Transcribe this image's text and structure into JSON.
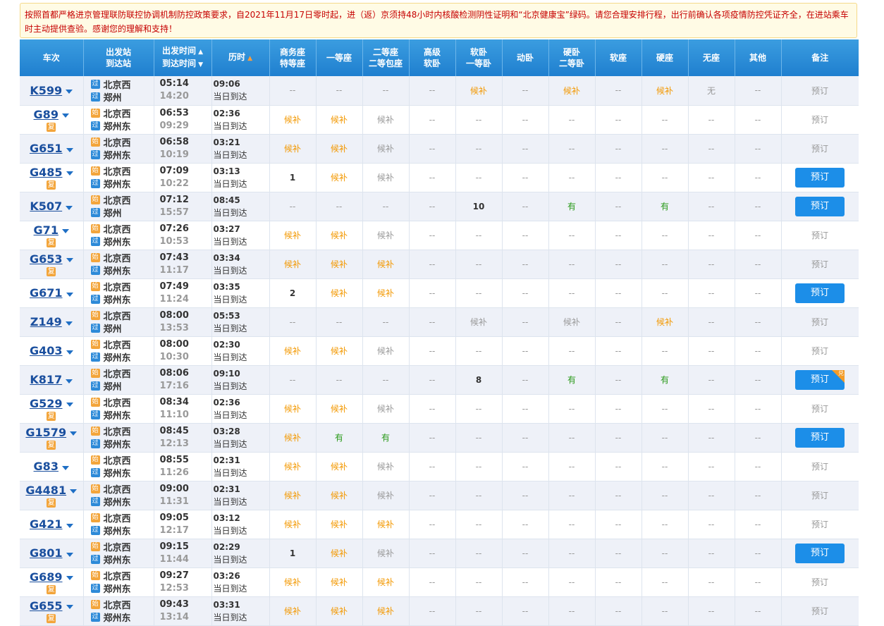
{
  "notice": "按照首都严格进京管理联防联控协调机制防控政策要求，自2021年11月17日零时起，进（返）京须持48小时内核酸检测阴性证明和“北京健康宝”绿码。请您合理安排行程，出行前确认各项疫情防控凭证齐全，在进站乘车时主动提供查验。感谢您的理解和支持！",
  "headers": {
    "train": "车次",
    "station_top": "出发站",
    "station_bot": "到达站",
    "time_top": "出发时间",
    "time_bot": "到达时间",
    "duration": "历时",
    "business_top": "商务座",
    "business_bot": "特等座",
    "first": "一等座",
    "second_top": "二等座",
    "second_bot": "二等包座",
    "high_soft_top": "高级",
    "high_soft_bot": "软卧",
    "soft_top": "软卧",
    "soft_bot": "一等卧",
    "dong": "动卧",
    "hard_top": "硬卧",
    "hard_bot": "二等卧",
    "soft_seat": "软座",
    "hard_seat": "硬座",
    "no_seat": "无座",
    "other": "其他",
    "note": "备注"
  },
  "labels": {
    "shi": "始",
    "guo": "过",
    "fu": "复",
    "same_day": "当日到达",
    "book": "预订",
    "dui": "兑"
  },
  "colors": {
    "header": "#1f7fcf",
    "book_button": "#1c8ee8",
    "waitlist": "#f39800",
    "available": "#2a9a1a",
    "alert_text": "#c60000"
  },
  "rows": [
    {
      "train": "K599",
      "fu": false,
      "from": "北京西",
      "to": "郑州",
      "from_badge": "guo",
      "dep": "05:14",
      "arr": "14:20",
      "dur": "09:06",
      "seats": [
        [
          "--",
          "g"
        ],
        [
          "--",
          "g"
        ],
        [
          "--",
          "g"
        ],
        [
          "--",
          "g"
        ],
        [
          "候补",
          "o"
        ],
        [
          "--",
          "g"
        ],
        [
          "候补",
          "o"
        ],
        [
          "--",
          "g"
        ],
        [
          "候补",
          "o"
        ],
        [
          "无",
          "g"
        ],
        [
          "--",
          "g"
        ]
      ],
      "book_active": false,
      "corner": false
    },
    {
      "train": "G89",
      "fu": true,
      "from": "北京西",
      "to": "郑州东",
      "from_badge": "shi",
      "dep": "06:53",
      "arr": "09:29",
      "dur": "02:36",
      "seats": [
        [
          "候补",
          "o"
        ],
        [
          "候补",
          "o"
        ],
        [
          "候补",
          "g"
        ],
        [
          "--",
          "g"
        ],
        [
          "--",
          "g"
        ],
        [
          "--",
          "g"
        ],
        [
          "--",
          "g"
        ],
        [
          "--",
          "g"
        ],
        [
          "--",
          "g"
        ],
        [
          "--",
          "g"
        ],
        [
          "--",
          "g"
        ]
      ],
      "book_active": false,
      "corner": false
    },
    {
      "train": "G651",
      "fu": false,
      "from": "北京西",
      "to": "郑州东",
      "from_badge": "shi",
      "dep": "06:58",
      "arr": "10:19",
      "dur": "03:21",
      "seats": [
        [
          "候补",
          "o"
        ],
        [
          "候补",
          "o"
        ],
        [
          "候补",
          "g"
        ],
        [
          "--",
          "g"
        ],
        [
          "--",
          "g"
        ],
        [
          "--",
          "g"
        ],
        [
          "--",
          "g"
        ],
        [
          "--",
          "g"
        ],
        [
          "--",
          "g"
        ],
        [
          "--",
          "g"
        ],
        [
          "--",
          "g"
        ]
      ],
      "book_active": false,
      "corner": false
    },
    {
      "train": "G485",
      "fu": true,
      "from": "北京西",
      "to": "郑州东",
      "from_badge": "shi",
      "dep": "07:09",
      "arr": "10:22",
      "dur": "03:13",
      "seats": [
        [
          "1",
          "n"
        ],
        [
          "候补",
          "o"
        ],
        [
          "候补",
          "g"
        ],
        [
          "--",
          "g"
        ],
        [
          "--",
          "g"
        ],
        [
          "--",
          "g"
        ],
        [
          "--",
          "g"
        ],
        [
          "--",
          "g"
        ],
        [
          "--",
          "g"
        ],
        [
          "--",
          "g"
        ],
        [
          "--",
          "g"
        ]
      ],
      "book_active": true,
      "corner": false
    },
    {
      "train": "K507",
      "fu": false,
      "from": "北京西",
      "to": "郑州",
      "from_badge": "shi",
      "dep": "07:12",
      "arr": "15:57",
      "dur": "08:45",
      "seats": [
        [
          "--",
          "g"
        ],
        [
          "--",
          "g"
        ],
        [
          "--",
          "g"
        ],
        [
          "--",
          "g"
        ],
        [
          "10",
          "n"
        ],
        [
          "--",
          "g"
        ],
        [
          "有",
          "gr"
        ],
        [
          "--",
          "g"
        ],
        [
          "有",
          "gr"
        ],
        [
          "--",
          "g"
        ],
        [
          "--",
          "g"
        ]
      ],
      "book_active": true,
      "corner": false
    },
    {
      "train": "G71",
      "fu": true,
      "from": "北京西",
      "to": "郑州东",
      "from_badge": "shi",
      "dep": "07:26",
      "arr": "10:53",
      "dur": "03:27",
      "seats": [
        [
          "候补",
          "o"
        ],
        [
          "候补",
          "o"
        ],
        [
          "候补",
          "g"
        ],
        [
          "--",
          "g"
        ],
        [
          "--",
          "g"
        ],
        [
          "--",
          "g"
        ],
        [
          "--",
          "g"
        ],
        [
          "--",
          "g"
        ],
        [
          "--",
          "g"
        ],
        [
          "--",
          "g"
        ],
        [
          "--",
          "g"
        ]
      ],
      "book_active": false,
      "corner": false
    },
    {
      "train": "G653",
      "fu": true,
      "from": "北京西",
      "to": "郑州东",
      "from_badge": "shi",
      "dep": "07:43",
      "arr": "11:17",
      "dur": "03:34",
      "seats": [
        [
          "候补",
          "o"
        ],
        [
          "候补",
          "o"
        ],
        [
          "候补",
          "o"
        ],
        [
          "--",
          "g"
        ],
        [
          "--",
          "g"
        ],
        [
          "--",
          "g"
        ],
        [
          "--",
          "g"
        ],
        [
          "--",
          "g"
        ],
        [
          "--",
          "g"
        ],
        [
          "--",
          "g"
        ],
        [
          "--",
          "g"
        ]
      ],
      "book_active": false,
      "corner": false
    },
    {
      "train": "G671",
      "fu": false,
      "from": "北京西",
      "to": "郑州东",
      "from_badge": "shi",
      "dep": "07:49",
      "arr": "11:24",
      "dur": "03:35",
      "seats": [
        [
          "2",
          "n"
        ],
        [
          "候补",
          "o"
        ],
        [
          "候补",
          "o"
        ],
        [
          "--",
          "g"
        ],
        [
          "--",
          "g"
        ],
        [
          "--",
          "g"
        ],
        [
          "--",
          "g"
        ],
        [
          "--",
          "g"
        ],
        [
          "--",
          "g"
        ],
        [
          "--",
          "g"
        ],
        [
          "--",
          "g"
        ]
      ],
      "book_active": true,
      "corner": false
    },
    {
      "train": "Z149",
      "fu": false,
      "from": "北京西",
      "to": "郑州",
      "from_badge": "shi",
      "dep": "08:00",
      "arr": "13:53",
      "dur": "05:53",
      "seats": [
        [
          "--",
          "g"
        ],
        [
          "--",
          "g"
        ],
        [
          "--",
          "g"
        ],
        [
          "--",
          "g"
        ],
        [
          "候补",
          "g"
        ],
        [
          "--",
          "g"
        ],
        [
          "候补",
          "g"
        ],
        [
          "--",
          "g"
        ],
        [
          "候补",
          "o"
        ],
        [
          "--",
          "g"
        ],
        [
          "--",
          "g"
        ]
      ],
      "book_active": false,
      "corner": false
    },
    {
      "train": "G403",
      "fu": false,
      "from": "北京西",
      "to": "郑州东",
      "from_badge": "shi",
      "dep": "08:00",
      "arr": "10:30",
      "dur": "02:30",
      "seats": [
        [
          "候补",
          "o"
        ],
        [
          "候补",
          "o"
        ],
        [
          "候补",
          "g"
        ],
        [
          "--",
          "g"
        ],
        [
          "--",
          "g"
        ],
        [
          "--",
          "g"
        ],
        [
          "--",
          "g"
        ],
        [
          "--",
          "g"
        ],
        [
          "--",
          "g"
        ],
        [
          "--",
          "g"
        ],
        [
          "--",
          "g"
        ]
      ],
      "book_active": false,
      "corner": false
    },
    {
      "train": "K817",
      "fu": false,
      "from": "北京西",
      "to": "郑州",
      "from_badge": "shi",
      "dep": "08:06",
      "arr": "17:16",
      "dur": "09:10",
      "seats": [
        [
          "--",
          "g"
        ],
        [
          "--",
          "g"
        ],
        [
          "--",
          "g"
        ],
        [
          "--",
          "g"
        ],
        [
          "8",
          "n"
        ],
        [
          "--",
          "g"
        ],
        [
          "有",
          "gr"
        ],
        [
          "--",
          "g"
        ],
        [
          "有",
          "gr"
        ],
        [
          "--",
          "g"
        ],
        [
          "--",
          "g"
        ]
      ],
      "book_active": true,
      "corner": true
    },
    {
      "train": "G529",
      "fu": true,
      "from": "北京西",
      "to": "郑州东",
      "from_badge": "shi",
      "dep": "08:34",
      "arr": "11:10",
      "dur": "02:36",
      "seats": [
        [
          "候补",
          "o"
        ],
        [
          "候补",
          "o"
        ],
        [
          "候补",
          "g"
        ],
        [
          "--",
          "g"
        ],
        [
          "--",
          "g"
        ],
        [
          "--",
          "g"
        ],
        [
          "--",
          "g"
        ],
        [
          "--",
          "g"
        ],
        [
          "--",
          "g"
        ],
        [
          "--",
          "g"
        ],
        [
          "--",
          "g"
        ]
      ],
      "book_active": false,
      "corner": false
    },
    {
      "train": "G1579",
      "fu": true,
      "from": "北京西",
      "to": "郑州东",
      "from_badge": "shi",
      "dep": "08:45",
      "arr": "12:13",
      "dur": "03:28",
      "seats": [
        [
          "候补",
          "o"
        ],
        [
          "有",
          "gr"
        ],
        [
          "有",
          "gr"
        ],
        [
          "--",
          "g"
        ],
        [
          "--",
          "g"
        ],
        [
          "--",
          "g"
        ],
        [
          "--",
          "g"
        ],
        [
          "--",
          "g"
        ],
        [
          "--",
          "g"
        ],
        [
          "--",
          "g"
        ],
        [
          "--",
          "g"
        ]
      ],
      "book_active": true,
      "corner": false
    },
    {
      "train": "G83",
      "fu": false,
      "from": "北京西",
      "to": "郑州东",
      "from_badge": "shi",
      "dep": "08:55",
      "arr": "11:26",
      "dur": "02:31",
      "seats": [
        [
          "候补",
          "o"
        ],
        [
          "候补",
          "o"
        ],
        [
          "候补",
          "g"
        ],
        [
          "--",
          "g"
        ],
        [
          "--",
          "g"
        ],
        [
          "--",
          "g"
        ],
        [
          "--",
          "g"
        ],
        [
          "--",
          "g"
        ],
        [
          "--",
          "g"
        ],
        [
          "--",
          "g"
        ],
        [
          "--",
          "g"
        ]
      ],
      "book_active": false,
      "corner": false
    },
    {
      "train": "G4481",
      "fu": true,
      "from": "北京西",
      "to": "郑州东",
      "from_badge": "shi",
      "dep": "09:00",
      "arr": "11:31",
      "dur": "02:31",
      "seats": [
        [
          "候补",
          "o"
        ],
        [
          "候补",
          "o"
        ],
        [
          "候补",
          "g"
        ],
        [
          "--",
          "g"
        ],
        [
          "--",
          "g"
        ],
        [
          "--",
          "g"
        ],
        [
          "--",
          "g"
        ],
        [
          "--",
          "g"
        ],
        [
          "--",
          "g"
        ],
        [
          "--",
          "g"
        ],
        [
          "--",
          "g"
        ]
      ],
      "book_active": false,
      "corner": false
    },
    {
      "train": "G421",
      "fu": false,
      "from": "北京西",
      "to": "郑州东",
      "from_badge": "shi",
      "dep": "09:05",
      "arr": "12:17",
      "dur": "03:12",
      "seats": [
        [
          "候补",
          "o"
        ],
        [
          "候补",
          "o"
        ],
        [
          "候补",
          "o"
        ],
        [
          "--",
          "g"
        ],
        [
          "--",
          "g"
        ],
        [
          "--",
          "g"
        ],
        [
          "--",
          "g"
        ],
        [
          "--",
          "g"
        ],
        [
          "--",
          "g"
        ],
        [
          "--",
          "g"
        ],
        [
          "--",
          "g"
        ]
      ],
      "book_active": false,
      "corner": false
    },
    {
      "train": "G801",
      "fu": false,
      "from": "北京西",
      "to": "郑州东",
      "from_badge": "shi",
      "dep": "09:15",
      "arr": "11:44",
      "dur": "02:29",
      "seats": [
        [
          "1",
          "n"
        ],
        [
          "候补",
          "o"
        ],
        [
          "候补",
          "g"
        ],
        [
          "--",
          "g"
        ],
        [
          "--",
          "g"
        ],
        [
          "--",
          "g"
        ],
        [
          "--",
          "g"
        ],
        [
          "--",
          "g"
        ],
        [
          "--",
          "g"
        ],
        [
          "--",
          "g"
        ],
        [
          "--",
          "g"
        ]
      ],
      "book_active": true,
      "corner": false
    },
    {
      "train": "G689",
      "fu": true,
      "from": "北京西",
      "to": "郑州东",
      "from_badge": "shi",
      "dep": "09:27",
      "arr": "12:53",
      "dur": "03:26",
      "seats": [
        [
          "候补",
          "o"
        ],
        [
          "候补",
          "o"
        ],
        [
          "候补",
          "o"
        ],
        [
          "--",
          "g"
        ],
        [
          "--",
          "g"
        ],
        [
          "--",
          "g"
        ],
        [
          "--",
          "g"
        ],
        [
          "--",
          "g"
        ],
        [
          "--",
          "g"
        ],
        [
          "--",
          "g"
        ],
        [
          "--",
          "g"
        ]
      ],
      "book_active": false,
      "corner": false
    },
    {
      "train": "G655",
      "fu": true,
      "from": "北京西",
      "to": "郑州东",
      "from_badge": "shi",
      "dep": "09:43",
      "arr": "13:14",
      "dur": "03:31",
      "seats": [
        [
          "候补",
          "o"
        ],
        [
          "候补",
          "o"
        ],
        [
          "候补",
          "o"
        ],
        [
          "--",
          "g"
        ],
        [
          "--",
          "g"
        ],
        [
          "--",
          "g"
        ],
        [
          "--",
          "g"
        ],
        [
          "--",
          "g"
        ],
        [
          "--",
          "g"
        ],
        [
          "--",
          "g"
        ],
        [
          "--",
          "g"
        ]
      ],
      "book_active": false,
      "corner": false
    }
  ]
}
